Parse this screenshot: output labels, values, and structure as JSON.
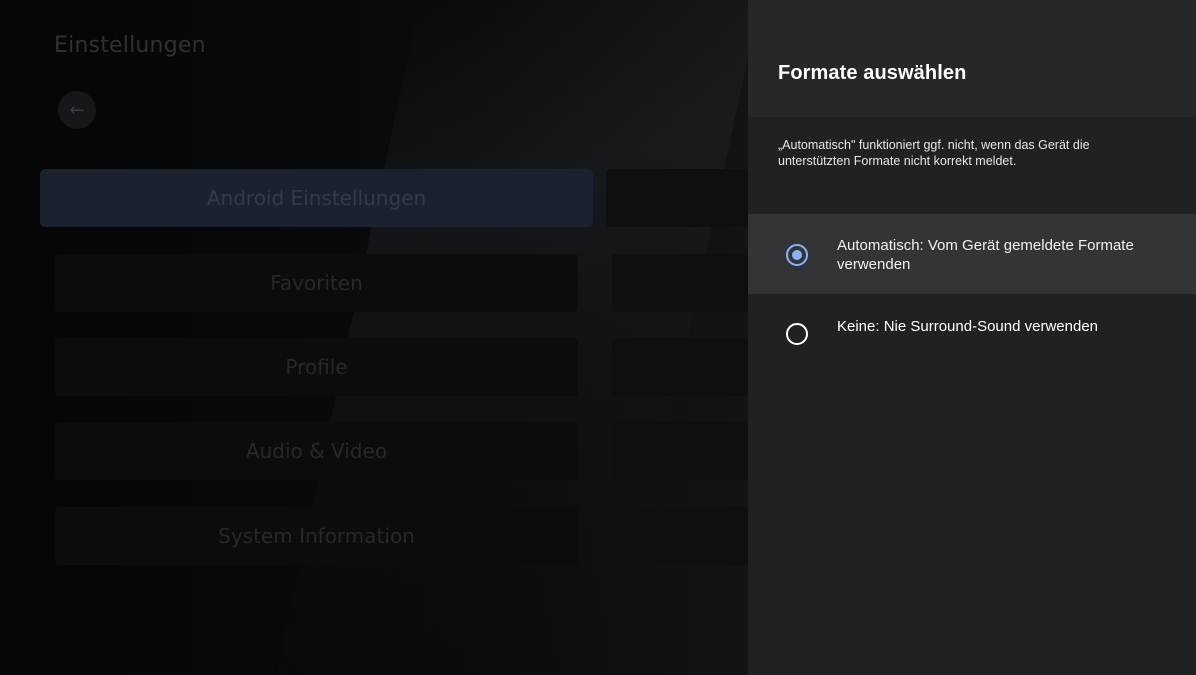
{
  "background": {
    "title": "Einstellungen",
    "back_icon": "arrow-left-icon",
    "menu": [
      {
        "label": "Android Einstellungen",
        "focused": true
      },
      {
        "label": "Favoriten",
        "focused": false
      },
      {
        "label": "Profile",
        "focused": false
      },
      {
        "label": "Audio & Video",
        "focused": false
      },
      {
        "label": "System Information",
        "focused": false
      }
    ]
  },
  "panel": {
    "title": "Formate auswählen",
    "description": "„Automatisch\" funktioniert ggf. nicht, wenn das Gerät die unterstützten Formate nicht korrekt meldet.",
    "options": [
      {
        "label": "Automatisch: Vom Gerät gemeldete Formate verwenden",
        "selected": true
      },
      {
        "label": "Keine: Nie Surround-Sound verwenden",
        "selected": false
      }
    ]
  },
  "colors": {
    "accent": "#8ab4f8",
    "panel_bg": "#202124",
    "selected_row_bg": "#333437"
  }
}
